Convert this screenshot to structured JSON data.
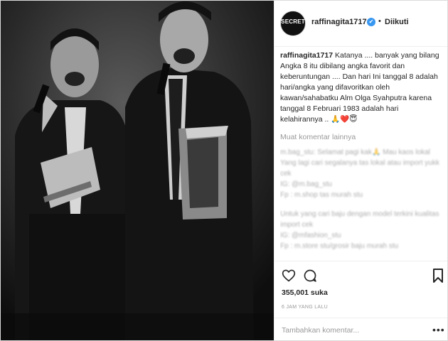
{
  "post": {
    "username": "raffinagita1717",
    "verified_mark": "✔",
    "separator": "•",
    "follow_label": "Diikuti",
    "avatar_text": "SECRET",
    "caption_user": "raffinagita1717",
    "caption_text": " Katanya .... banyak yang bilang Angka 8 itu dibilang angka favorit dan keberuntungan .... Dan hari Ini tanggal 8 adalah hari/angka yang difavoritkan oleh kawan/sahabatku Alm Olga Syahputra karena tanggal 8 Februari 1983 adalah hari kelahirannya .. 🙏❤️😇",
    "more_comments_label": "Muat komentar lainnya",
    "blurred_comments": [
      "m.bag_stu: Selamat pagi kak🙏 Mau kaos lokal",
      "Yang lagi cari segalanya tas lokal atau import yukk cek",
      "IG: @m.bag_stu",
      "Fp : m.shop tas murah stu",
      "Untuk yang cari baju dengan model terkini kualitas import cek",
      "IG: @mfashion_stu",
      "Fp : m.store stu/grosir baju murah stu"
    ],
    "likes_text": "355,001 suka",
    "time_text": "6 JAM YANG LALU",
    "comment_placeholder": "Tambahkan komentar...",
    "more_options": "•••"
  },
  "icons": [
    "verified-icon",
    "heart-icon",
    "comment-icon",
    "bookmark-icon",
    "more-options-icon"
  ],
  "colors": {
    "verified": "#3897f0",
    "muted": "#999999",
    "text": "#262626",
    "border": "#efefef"
  }
}
